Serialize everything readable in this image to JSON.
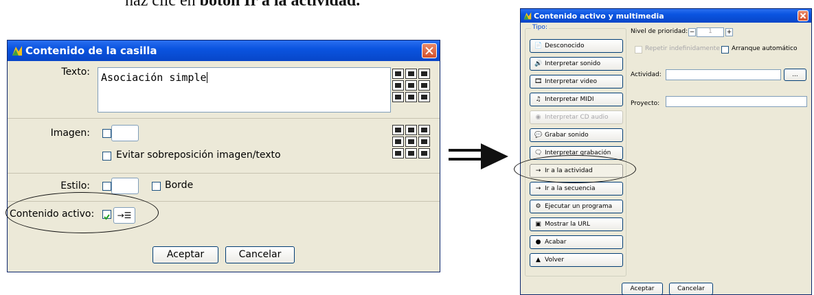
{
  "doc": {
    "line_prefix": "haz clic en ",
    "line_bold": "botón Ir a la actividad."
  },
  "left_dialog": {
    "title": "Contenido de la casilla",
    "text_label": "Texto:",
    "text_value": "Asociación simple",
    "image_label": "Imagen:",
    "avoid_overlap_label": "Evitar sobreposición imagen/texto",
    "style_label": "Estilo:",
    "border_label": "Borde",
    "active_content_label": "Contenido activo:",
    "active_content_checked": true,
    "accept_label": "Aceptar",
    "cancel_label": "Cancelar",
    "icons": {
      "title": "app-icon",
      "close": "close-icon",
      "active": "goto-activity-icon"
    }
  },
  "right_dialog": {
    "title": "Contenido activo y multimedia",
    "type_legend": "Tipo:",
    "type_buttons": [
      {
        "label": "Desconocido",
        "icon": "📄",
        "disabled": false,
        "selected": false
      },
      {
        "label": "Interpretar sonido",
        "icon": "🔊",
        "disabled": false,
        "selected": false
      },
      {
        "label": "Interpretar video",
        "icon": "🎞",
        "disabled": false,
        "selected": false
      },
      {
        "label": "Interpretar MIDI",
        "icon": "♫",
        "disabled": false,
        "selected": false
      },
      {
        "label": "Interpretar CD audio",
        "icon": "◉",
        "disabled": true,
        "selected": false
      },
      {
        "label": "Grabar sonido",
        "icon": "💬",
        "disabled": false,
        "selected": false
      },
      {
        "label": "Interpretar grabación",
        "icon": "🗨",
        "disabled": false,
        "selected": false
      },
      {
        "label": "Ir a la actividad",
        "icon": "→",
        "disabled": false,
        "selected": true
      },
      {
        "label": "Ir a la secuencia",
        "icon": "→",
        "disabled": false,
        "selected": false
      },
      {
        "label": "Ejecutar un programa",
        "icon": "⚙",
        "disabled": false,
        "selected": false
      },
      {
        "label": "Mostrar la URL",
        "icon": "▣",
        "disabled": false,
        "selected": false
      },
      {
        "label": "Acabar",
        "icon": "●",
        "disabled": false,
        "selected": false
      },
      {
        "label": "Volver",
        "icon": "▲",
        "disabled": false,
        "selected": false
      }
    ],
    "priority_label": "Nivel de prioridad:",
    "priority_value": "1",
    "repeat_label": "Repetir indefinidamente",
    "autostart_label": "Arranque automático",
    "activity_label": "Actividad:",
    "activity_value": "",
    "browse_label": "...",
    "project_label": "Proyecto:",
    "project_value": "",
    "accept_label": "Aceptar",
    "cancel_label": "Cancelar",
    "colors": {
      "title_bar": "#0a54e0",
      "window_bg": "#ece9d8"
    }
  }
}
